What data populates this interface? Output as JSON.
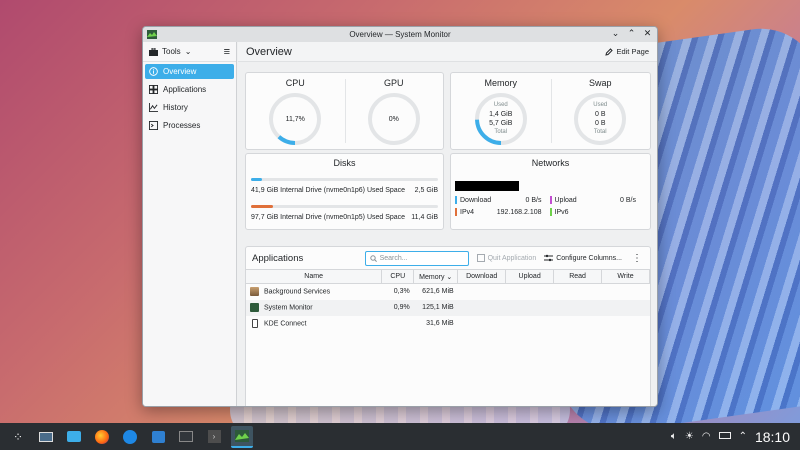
{
  "window": {
    "title": "Overview — System Monitor",
    "controls": {
      "minimize": "⌄",
      "maximize": "⌃",
      "close": "✕"
    }
  },
  "sidebar": {
    "tools_label": "Tools",
    "items": [
      {
        "label": "Overview",
        "icon": "info-icon",
        "active": true
      },
      {
        "label": "Applications",
        "icon": "grid-icon",
        "active": false
      },
      {
        "label": "History",
        "icon": "history-chart-icon",
        "active": false
      },
      {
        "label": "Processes",
        "icon": "terminal-icon",
        "active": false
      }
    ]
  },
  "header": {
    "title": "Overview",
    "edit_label": "Edit Page"
  },
  "cpu_gpu": {
    "cpu": {
      "title": "CPU",
      "value": "11,7%",
      "fraction": 0.117
    },
    "gpu": {
      "title": "GPU",
      "value": "0%",
      "fraction": 0
    }
  },
  "mem_swap": {
    "memory": {
      "title": "Memory",
      "used_label": "Used",
      "used": "1,4 GiB",
      "total": "5,7 GiB",
      "total_label": "Total",
      "fraction": 0.245
    },
    "swap": {
      "title": "Swap",
      "used_label": "Used",
      "used": "0 B",
      "total": "0 B",
      "total_label": "Total",
      "fraction": 0
    }
  },
  "disks": {
    "title": "Disks",
    "items": [
      {
        "label": "41,9 GiB Internal Drive (nvme0n1p6) Used Space",
        "value": "2,5 GiB",
        "fraction": 0.06,
        "color": "#3daee9"
      },
      {
        "label": "97,7 GiB Internal Drive (nvme0n1p5) Used Space",
        "value": "11,4 GiB",
        "fraction": 0.12,
        "color": "#e0703a"
      }
    ]
  },
  "networks": {
    "title": "Networks",
    "download": {
      "label": "Download",
      "value": "0 B/s",
      "color": "#3daee9"
    },
    "upload": {
      "label": "Upload",
      "value": "0 B/s",
      "color": "#c34ed1"
    },
    "ipv4": {
      "label": "IPv4",
      "value": "192.168.2.108",
      "color": "#e0703a"
    },
    "ipv6": {
      "label": "IPv6",
      "value": "",
      "color": "#6fd14b"
    }
  },
  "applications": {
    "title": "Applications",
    "search_placeholder": "Search...",
    "quit_label": "Quit Application",
    "configure_label": "Configure Columns...",
    "columns": [
      "Name",
      "CPU",
      "Memory",
      "Download",
      "Upload",
      "Read",
      "Write"
    ],
    "rows": [
      {
        "name": "Background Services",
        "cpu": "0,3%",
        "memory": "621,6 MiB",
        "icon": "background-services-icon"
      },
      {
        "name": "System Monitor",
        "cpu": "0,9%",
        "memory": "125,1 MiB",
        "icon": "system-monitor-icon"
      },
      {
        "name": "KDE Connect",
        "cpu": "",
        "memory": "31,6 MiB",
        "icon": "kde-connect-icon"
      }
    ]
  },
  "taskbar": {
    "apps": [
      "app-launcher-icon",
      "system-settings-icon",
      "file-manager-icon",
      "firefox-icon",
      "discover-icon",
      "store-icon",
      "konsole-icon",
      "terminal-icon",
      "system-monitor-icon"
    ],
    "clock": "18:10"
  },
  "colors": {
    "accent": "#3daee9",
    "taskbar": "#2a2e32"
  }
}
